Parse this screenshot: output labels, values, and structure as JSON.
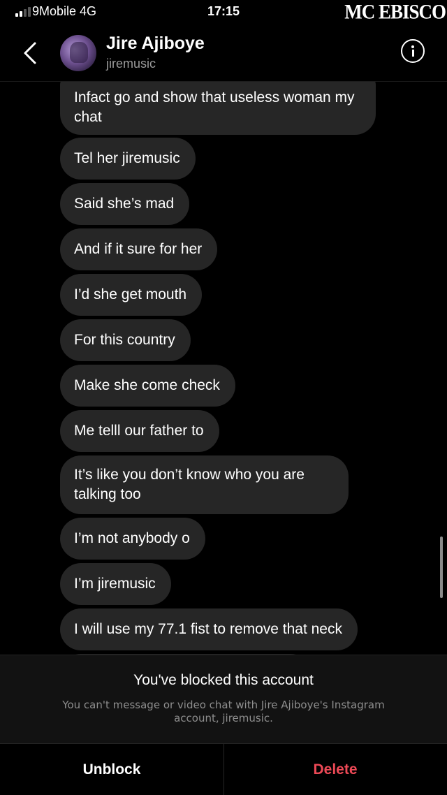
{
  "status_bar": {
    "carrier": "9Mobile  4G",
    "time": "17:15",
    "watermark": "MC EBISCO"
  },
  "header": {
    "name": "Jire Ajiboye",
    "username": "jiremusic",
    "back_icon": "chevron-left-icon",
    "info_icon": "info-icon"
  },
  "messages": [
    {
      "text": "Infact go and show that useless woman my chat"
    },
    {
      "text": "Tel her jiremusic"
    },
    {
      "text": "Said she’s mad"
    },
    {
      "text": "And if it sure for her"
    },
    {
      "text": "I’d she get mouth"
    },
    {
      "text": "For this country"
    },
    {
      "text": "Make she come check"
    },
    {
      "text": "Me telll our father to"
    },
    {
      "text": "It’s like you don’t know who you are talking too"
    },
    {
      "text": "I’m not anybody o"
    },
    {
      "text": "I’m jiremusic"
    },
    {
      "text": "I will use my 77.1 fist to remove that neck"
    }
  ],
  "blocked": {
    "title": "You've blocked this account",
    "description": "You can't message or video chat with Jire Ajiboye's Instagram account, jiremusic."
  },
  "actions": {
    "unblock_label": "Unblock",
    "delete_label": "Delete"
  },
  "colors": {
    "background": "#000000",
    "bubble": "#262626",
    "delete": "#ed4956",
    "secondary_text": "#8e8e8e"
  }
}
